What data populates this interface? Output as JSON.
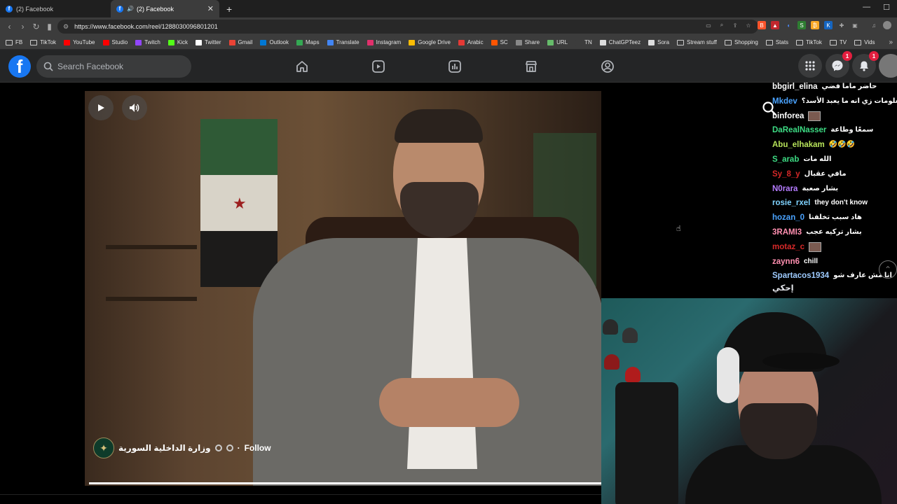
{
  "browser": {
    "tabs": [
      {
        "label": "(2) Facebook",
        "active": false
      },
      {
        "label": "(2) Facebook",
        "active": true
      }
    ],
    "new_tab": "+",
    "url": "https://www.facebook.com/reel/1288030096801201",
    "bookmarks": [
      {
        "label": "FB",
        "icon": "folder"
      },
      {
        "label": "TikTok",
        "icon": "folder"
      },
      {
        "label": "YouTube",
        "icon": "youtube",
        "color": "#ff0000"
      },
      {
        "label": "Studio",
        "icon": "youtube-studio",
        "color": "#ff0000"
      },
      {
        "label": "Twitch",
        "icon": "twitch",
        "color": "#9146ff"
      },
      {
        "label": "Kick",
        "icon": "kick",
        "color": "#53fc18"
      },
      {
        "label": "Twitter",
        "icon": "x",
        "color": "#ffffff"
      },
      {
        "label": "Gmail",
        "icon": "gmail",
        "color": "#ea4335"
      },
      {
        "label": "Outlook",
        "icon": "outlook",
        "color": "#0078d4"
      },
      {
        "label": "Maps",
        "icon": "maps",
        "color": "#34a853"
      },
      {
        "label": "Translate",
        "icon": "translate",
        "color": "#4285f4"
      },
      {
        "label": "Instagram",
        "icon": "instagram",
        "color": "#e1306c"
      },
      {
        "label": "Google Drive",
        "icon": "drive",
        "color": "#fbbc04"
      },
      {
        "label": "Arabic",
        "icon": "arabic",
        "color": "#e53935"
      },
      {
        "label": "SC",
        "icon": "soundcloud",
        "color": "#ff5500"
      },
      {
        "label": "Share",
        "icon": "cloud",
        "color": "#888888"
      },
      {
        "label": "URL",
        "icon": "url",
        "color": "#66bb6a"
      },
      {
        "label": "TN",
        "icon": "tn",
        "color": "#3c3c3c"
      },
      {
        "label": "ChatGPTeez",
        "icon": "chatgpt",
        "color": "#dddddd"
      },
      {
        "label": "Sora",
        "icon": "sora",
        "color": "#dddddd"
      },
      {
        "label": "Stream stuff",
        "icon": "folder"
      },
      {
        "label": "Shopping",
        "icon": "folder"
      },
      {
        "label": "Stats",
        "icon": "folder"
      },
      {
        "label": "TikTok",
        "icon": "folder"
      },
      {
        "label": "TV",
        "icon": "folder"
      },
      {
        "label": "Vids",
        "icon": "folder"
      }
    ],
    "bookmarks_more": "»"
  },
  "facebook": {
    "logo": "f",
    "search_placeholder": "Search Facebook",
    "messenger_badge": "1",
    "notifications_badge": "1"
  },
  "reel": {
    "page_name": "وزارة الداخلية السورية",
    "follow_label": "Follow",
    "separator": "·",
    "progress": 1.0
  },
  "chat": [
    {
      "user": "bbgirl_elina",
      "color": "#ffffff",
      "msg": "حاضر ماما فضي"
    },
    {
      "user": "Mkdev",
      "color": "#4aa3ff",
      "msg": "معلومات زي انه ما يعبد الأسد؟"
    },
    {
      "user": "binforea",
      "color": "#ffffff",
      "msg": "",
      "emote": true
    },
    {
      "user": "DaRealNasser",
      "color": "#3ddc84",
      "msg": "سمعًا وطاعة"
    },
    {
      "user": "Abu_elhakam",
      "color": "#b7e35a",
      "msg": "🤣🤣🤣"
    },
    {
      "user": "S_arab",
      "color": "#3ddc84",
      "msg": "الله مات"
    },
    {
      "user": "Sy_8_y",
      "color": "#d62828",
      "msg": "مافي عقبال"
    },
    {
      "user": "N0rara",
      "color": "#b57cff",
      "msg": "بشار صعبة"
    },
    {
      "user": "rosie_rxel",
      "color": "#7fd3ff",
      "msg": "they don't know"
    },
    {
      "user": "hozan_0",
      "color": "#4aa3ff",
      "msg": "هاد سبب تخلفنا"
    },
    {
      "user": "3RAMI3",
      "color": "#ff8fb0",
      "msg": "بشار تركيه عجب"
    },
    {
      "user": "motaz_c",
      "color": "#d62828",
      "msg": "",
      "emote": true
    },
    {
      "user": "zaynn6",
      "color": "#ff8fb0",
      "msg": "chill"
    },
    {
      "user": "Spartacos1934",
      "color": "#9ecbff",
      "msg": "انا مش عارف شو",
      "msg2": "إحكي"
    }
  ]
}
